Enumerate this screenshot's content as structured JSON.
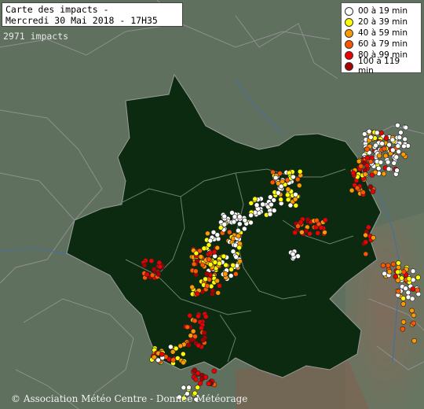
{
  "title": {
    "line1": "Carte des impacts -",
    "line2": "Mercredi 30 Mai 2018 - 17H35"
  },
  "impacts_label": "2971 impacts",
  "legend": [
    {
      "label": "00 à 19 min",
      "color": "#ffffff"
    },
    {
      "label": "20 à 39 min",
      "color": "#ffff00"
    },
    {
      "label": "40 à 59 min",
      "color": "#ff9900"
    },
    {
      "label": "60 à 79 min",
      "color": "#ff5500"
    },
    {
      "label": "80 à 99 min",
      "color": "#ee0000"
    },
    {
      "label": "100 à 119 min",
      "color": "#aa0000"
    }
  ],
  "credit": "© Association Météo Centre - Donnée Météorage",
  "colors": {
    "region": "#0d2a10",
    "outside": "#5d6e5d",
    "borders": "#8a8a8a",
    "rivers": "#4a6c90"
  }
}
